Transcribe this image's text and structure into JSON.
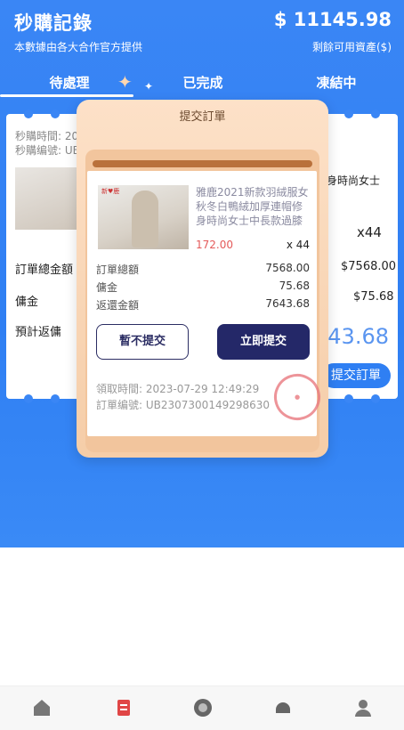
{
  "header": {
    "title": "秒購記錄",
    "subtitle": "本數據由各大合作官方提供",
    "balance": "$ 11145.98",
    "balance_label": "剩餘可用資產($)"
  },
  "tabs": [
    {
      "label": "待處理",
      "active": true
    },
    {
      "label": "已完成",
      "active": false
    },
    {
      "label": "凍結中",
      "active": false
    }
  ],
  "background_card": {
    "time_label": "秒購時間: 20",
    "number_label": "秒購编號: UB",
    "product_suffix": "身時尚女士",
    "qty": "x44",
    "total_label": "訂單總金額",
    "total_value": "$7568.00",
    "commission_label": "傭金",
    "commission_value": "$75.68",
    "refund_label": "預計返傭",
    "refund_value": "543.68",
    "submit_label": "提交訂單"
  },
  "modal": {
    "title": "提交訂單",
    "product": {
      "name": "雅鹿2021新款羽絨服女秋冬白鴨絨加厚連帽修身時尚女士中長款過膝",
      "price": "172.00",
      "qty": "x 44",
      "image_logo": "新♥鹿"
    },
    "rows": [
      {
        "label": "訂單總額",
        "value": "7568.00"
      },
      {
        "label": "傭金",
        "value": "75.68"
      },
      {
        "label": "返還金額",
        "value": "7643.68"
      }
    ],
    "cancel_label": "暫不提交",
    "submit_label": "立即提交",
    "claim_time": "領取時間:  2023-07-29 12:49:29",
    "order_number": "訂單编號:  UB2307300149298630"
  },
  "colors": {
    "primary_blue": "#2f7ff3",
    "modal_peach": "#f5cda8",
    "submit_navy": "#242868",
    "price_red": "#e45a5a"
  },
  "bottom_nav": [
    {
      "icon": "home-icon"
    },
    {
      "icon": "orders-icon"
    },
    {
      "icon": "grab-icon"
    },
    {
      "icon": "service-icon"
    },
    {
      "icon": "profile-icon"
    }
  ]
}
